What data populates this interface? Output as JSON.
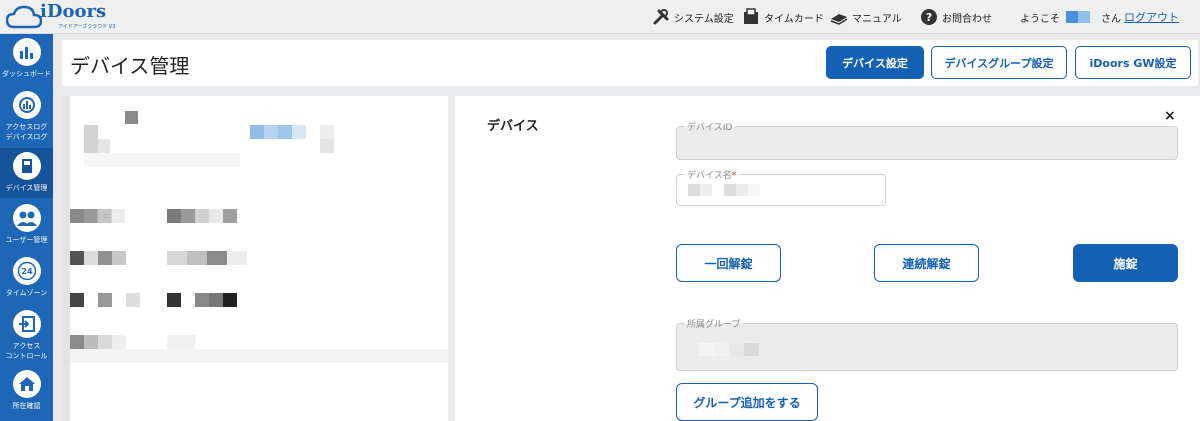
{
  "app": {
    "logo_text": "iDoors",
    "logo_sub": "アイドアーズクラウド V3"
  },
  "topnav": {
    "system_settings": "システム設定",
    "timecard": "タイムカード",
    "manual": "マニュアル",
    "contact": "お問合わせ",
    "welcome": "ようこそ",
    "san": "さん",
    "logout": "ログアウト"
  },
  "sidebar": {
    "items": [
      {
        "label": "ダッシュボード",
        "icon": "dashboard-icon"
      },
      {
        "label": "アクセスログ\nデバイスログ",
        "icon": "access-log-icon"
      },
      {
        "label": "デバイス管理",
        "icon": "device-icon"
      },
      {
        "label": "ユーザー管理",
        "icon": "users-icon"
      },
      {
        "label": "タイムゾーン",
        "icon": "timezone-24-icon"
      },
      {
        "label": "アクセス\nコントロール",
        "icon": "access-control-icon"
      },
      {
        "label": "所在確認",
        "icon": "home-icon"
      }
    ]
  },
  "header": {
    "title": "デバイス管理",
    "btn_device_settings": "デバイス設定",
    "btn_group_settings": "デバイスグループ設定",
    "btn_gw_settings": "iDoors GW設定"
  },
  "detail": {
    "section_title": "デバイス",
    "close": "×",
    "device_id_label": "デバイスID",
    "device_name_label": "デバイス名",
    "required_mark": "*",
    "btn_unlock_once": "一回解錠",
    "btn_unlock_continuous": "連続解錠",
    "btn_lock": "施錠",
    "group_label": "所属グループ",
    "btn_add_group": "グループ追加をする"
  },
  "colors": {
    "brand": "#1461b3",
    "sidebar": "#1e67b6",
    "sidebar_active": "#15539a"
  }
}
